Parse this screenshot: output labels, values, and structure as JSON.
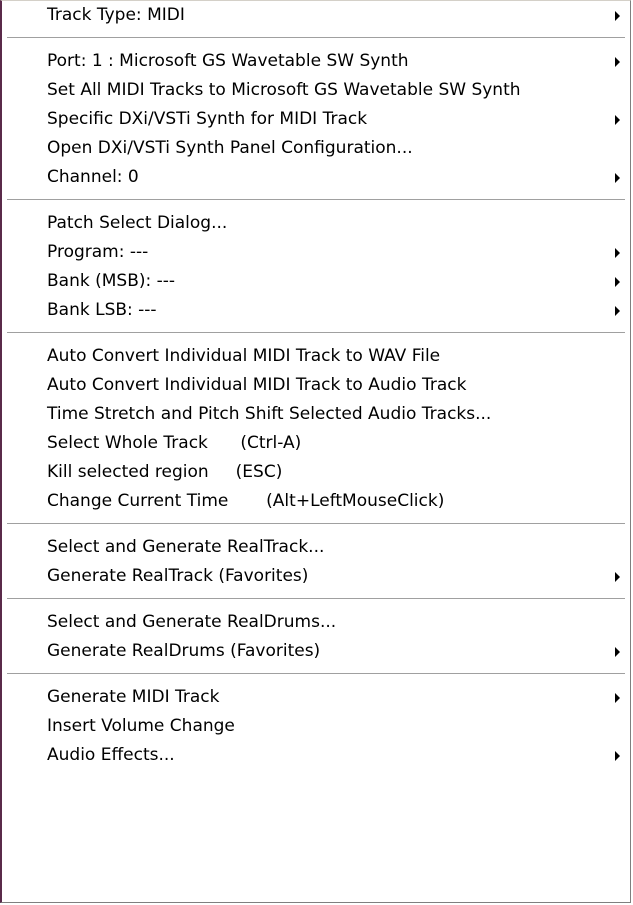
{
  "menu": {
    "groups": [
      {
        "items": [
          {
            "label": "Track Type: MIDI",
            "submenu": true
          }
        ]
      },
      {
        "items": [
          {
            "label": "Port: 1 : Microsoft GS Wavetable SW Synth",
            "submenu": true
          },
          {
            "label": "Set All MIDI Tracks to Microsoft GS Wavetable SW Synth",
            "submenu": false
          },
          {
            "label": "Specific DXi/VSTi Synth for MIDI Track",
            "submenu": true
          },
          {
            "label": "Open DXi/VSTi Synth Panel Configuration...",
            "submenu": false
          },
          {
            "label": "Channel: 0",
            "submenu": true
          }
        ]
      },
      {
        "items": [
          {
            "label": "Patch Select Dialog...",
            "submenu": false
          },
          {
            "label": "Program: ---",
            "submenu": true
          },
          {
            "label": "Bank (MSB): ---",
            "submenu": true
          },
          {
            "label": "Bank LSB: ---",
            "submenu": true
          }
        ]
      },
      {
        "items": [
          {
            "label": "Auto Convert Individual MIDI Track to WAV File",
            "submenu": false
          },
          {
            "label": "Auto Convert Individual MIDI Track to Audio Track",
            "submenu": false
          },
          {
            "label": "Time Stretch and Pitch Shift Selected Audio Tracks...",
            "submenu": false
          },
          {
            "label": "Select Whole Track      (Ctrl-A)",
            "submenu": false
          },
          {
            "label": "Kill selected region     (ESC)",
            "submenu": false
          },
          {
            "label": "Change Current Time       (Alt+LeftMouseClick)",
            "submenu": false
          }
        ]
      },
      {
        "items": [
          {
            "label": "Select and Generate RealTrack...",
            "submenu": false
          },
          {
            "label": "Generate RealTrack (Favorites)",
            "submenu": true
          }
        ]
      },
      {
        "items": [
          {
            "label": "Select and Generate RealDrums...",
            "submenu": false
          },
          {
            "label": "Generate RealDrums (Favorites)",
            "submenu": true
          }
        ]
      },
      {
        "items": [
          {
            "label": "Generate MIDI Track",
            "submenu": true
          },
          {
            "label": "Insert Volume Change",
            "submenu": false
          },
          {
            "label": "Audio Effects...",
            "submenu": true
          }
        ]
      }
    ]
  }
}
